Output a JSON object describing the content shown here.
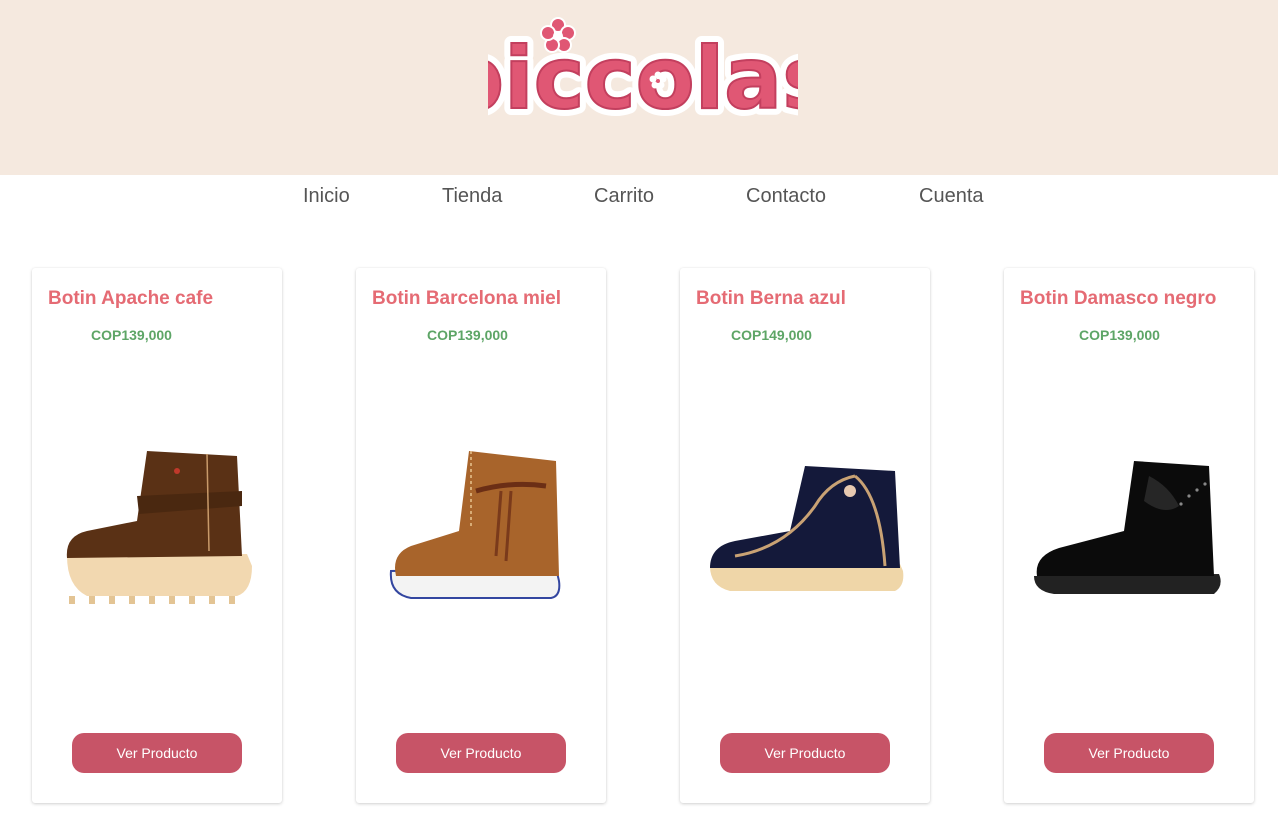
{
  "brand": {
    "logo_text": "piccolas",
    "primary_color": "#e05774",
    "header_bg": "#f5e9df"
  },
  "nav": {
    "items": [
      {
        "label": "Inicio"
      },
      {
        "label": "Tienda"
      },
      {
        "label": "Carrito"
      },
      {
        "label": "Contacto"
      },
      {
        "label": "Cuenta"
      }
    ]
  },
  "products": [
    {
      "name": "Botin Apache cafe",
      "price": "COP139,000",
      "button": "Ver Producto",
      "color": "brown suede",
      "icon": "boot-image"
    },
    {
      "name": "Botin Barcelona miel",
      "price": "COP139,000",
      "button": "Ver Producto",
      "color": "honey suede",
      "icon": "boot-image"
    },
    {
      "name": "Botin Berna azul",
      "price": "COP149,000",
      "button": "Ver Producto",
      "color": "navy blue",
      "icon": "boot-image"
    },
    {
      "name": "Botin Damasco negro",
      "price": "COP139,000",
      "button": "Ver Producto",
      "color": "black",
      "icon": "boot-image"
    }
  ],
  "colors": {
    "title": "#e56b74",
    "price": "#5da566",
    "button": "#c75467"
  }
}
